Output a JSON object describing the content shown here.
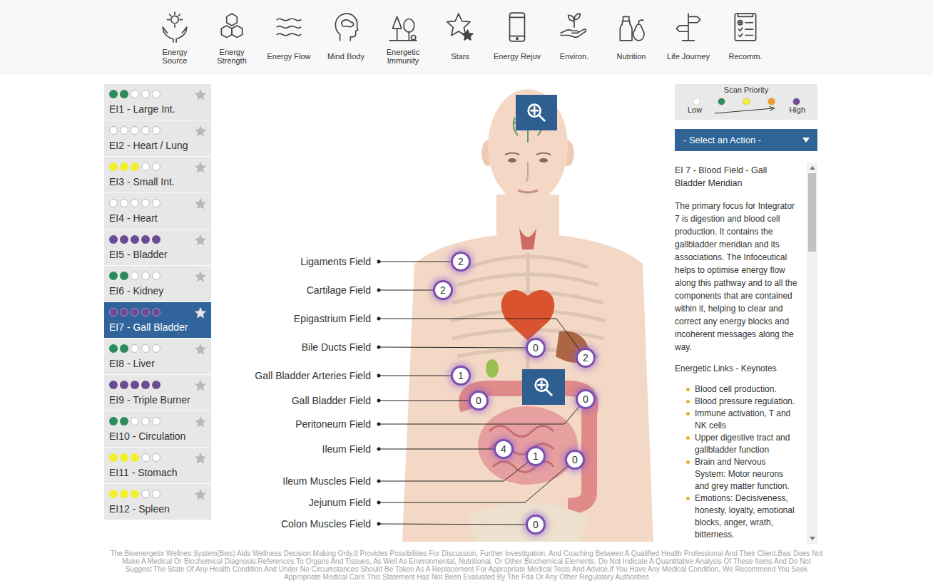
{
  "nav": [
    {
      "label": "Energy Source"
    },
    {
      "label": "Energy Strength"
    },
    {
      "label": "Energy Flow"
    },
    {
      "label": "Mind Body"
    },
    {
      "label": "Energetic Immunity"
    },
    {
      "label": "Stars"
    },
    {
      "label": "Energy Rejuv"
    },
    {
      "label": "Environ."
    },
    {
      "label": "Nutrition"
    },
    {
      "label": "Life Journey"
    },
    {
      "label": "Recomm."
    }
  ],
  "sidebar": {
    "scale": 5,
    "items": [
      {
        "label": "EI1 - Large Int.",
        "filled": 2,
        "color": "#2e8b5a",
        "selected": false
      },
      {
        "label": "EI2 - Heart / Lung",
        "filled": 0,
        "selected": false
      },
      {
        "label": "EI3 - Small Int.",
        "filled": 3,
        "color": "#f2ef2c",
        "selected": false
      },
      {
        "label": "EI4 - Heart",
        "filled": 0,
        "selected": false
      },
      {
        "label": "EI5 - Bladder",
        "filled": 5,
        "color": "#6d4a94",
        "selected": false
      },
      {
        "label": "EI6 - Kidney",
        "filled": 2,
        "color": "#2e8b5a",
        "selected": false
      },
      {
        "label": "EI7 - Gall Bladder",
        "filled": 5,
        "color": "#6d4a94",
        "selected": true
      },
      {
        "label": "EI8 - Liver",
        "filled": 2,
        "color": "#2e8b5a",
        "selected": false
      },
      {
        "label": "EI9 - Triple Burner",
        "filled": 5,
        "color": "#6d4a94",
        "selected": false
      },
      {
        "label": "EI10 - Circulation",
        "filled": 2,
        "color": "#2e8b5a",
        "selected": false
      },
      {
        "label": "EI11 - Stomach",
        "filled": 3,
        "color": "#f2ef2c",
        "selected": false
      },
      {
        "label": "EI12 - Spleen",
        "filled": 3,
        "color": "#f2ef2c",
        "selected": false
      }
    ]
  },
  "diagram": {
    "fields": [
      {
        "label": "Ligaments Field",
        "value": "2"
      },
      {
        "label": "Cartilage Field",
        "value": "2"
      },
      {
        "label": "Epigastrium Field",
        "value": "2"
      },
      {
        "label": "Bile Ducts Field",
        "value": "0"
      },
      {
        "label": "Gall Bladder Arteries Field",
        "value": "1"
      },
      {
        "label": "Gall Bladder Field",
        "value": "0"
      },
      {
        "label": "Peritoneum Field",
        "value": "0"
      },
      {
        "label": "Ileum Field",
        "value": "4"
      },
      {
        "label": "Ileum Muscles Field",
        "value": "1"
      },
      {
        "label": "Jejunum Field",
        "value": "0"
      },
      {
        "label": "Colon Muscles Field",
        "value": "0"
      }
    ]
  },
  "legend": {
    "title": "Scan Priority",
    "low": "Low",
    "high": "High",
    "levels": [
      {
        "color": "#ffffff"
      },
      {
        "color": "#2e8b5a"
      },
      {
        "color": "#f2ef2c"
      },
      {
        "color": "#f39a21"
      },
      {
        "color": "#6d4a94"
      }
    ]
  },
  "action": {
    "placeholder": "- Select an Action -"
  },
  "info": {
    "title": "EI 7 - Blood Field - Gall Bladder Meridian",
    "body": "The primary focus for Integrator 7 is digestion and blood cell production. It contains the gallbladder meridian and its associations. The Infoceutical helps to optimise energy flow along this pathway and to all the components that are contained within it, helping to clear and correct any energy blocks and incoherent messages along the way.",
    "links_heading": "Energetic Links - Keynotes",
    "links": [
      "Blood cell production.",
      "Blood pressure regulation.",
      "Immune activation, T and NK cells",
      "Upper digestive tract and gallbladder function",
      "Brain and Nervous System: Motor neurons and grey matter function.",
      "Emotions: Decisiveness, honesty, loyalty, emotional blocks, anger, wrath, bitterness."
    ]
  },
  "footer": {
    "disclaimer": "The Bioenergetix Wellnes System(Bws) Aids Wellness Decision Making Only.It Provides Possibilities For Discussion, Further Investigation, And Coaching Between A Qualified Health Professional And Their Client.Bws Does Not Make A Medical Or Biochemical Diagnosis.References To Organs And Tissues, As Well As Environmental, Nutritional, Or Other Biochemical Elements, Do Not Indicate A Quantitative Analysis Of These Items And Do Not Suggest The State Of Any Health Condition And Under No Circumstances Should Be Taken As A Replacement For Appropriate Medical Tests And Advice.If You Have Any Medical Condition, We Recommend You Seek Appropriate Medical Care.This Statement Has Not Been Evaluated By The Fda Or Any Other Regulatory Authorities"
  }
}
